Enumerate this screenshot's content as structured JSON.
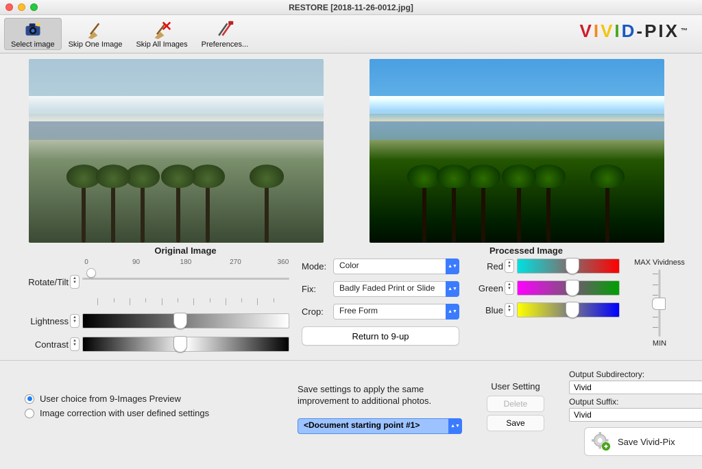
{
  "window": {
    "title": "RESTORE [2018-11-26-0012.jpg]"
  },
  "brand": {
    "word1": "VIVID",
    "word2": "-PIX"
  },
  "toolbar": {
    "select_image": "Select image",
    "skip_one": "Skip One Image",
    "skip_all": "Skip All Images",
    "preferences": "Preferences..."
  },
  "captions": {
    "original": "Original Image",
    "processed": "Processed Image"
  },
  "left_controls": {
    "rotate_label": "Rotate/Tilt",
    "rotate_ticks": [
      "0",
      "90",
      "180",
      "270",
      "360"
    ],
    "lightness_label": "Lightness",
    "contrast_label": "Contrast"
  },
  "mid_controls": {
    "mode_label": "Mode:",
    "mode_value": "Color",
    "fix_label": "Fix:",
    "fix_value": "Badly Faded Print or Slide",
    "crop_label": "Crop:",
    "crop_value": "Free Form",
    "return_label": "Return to 9-up"
  },
  "right_controls": {
    "red_label": "Red",
    "green_label": "Green",
    "blue_label": "Blue",
    "max_label": "MAX Vividness",
    "min_label": "MIN"
  },
  "bottom": {
    "radio1": "User choice from 9-Images Preview",
    "radio2": "Image correction with user defined settings",
    "save_hint": "Save settings to apply the same improvement to additional photos.",
    "doc_select": "<Document starting point #1>",
    "user_setting_hdr": "User Setting",
    "delete_btn": "Delete",
    "save_btn": "Save",
    "out_subdir_label": "Output Subdirectory:",
    "out_subdir_value": "Vivid",
    "out_suffix_label": "Output Suffix:",
    "out_suffix_value": "Vivid",
    "save_vivid": "Save Vivid-Pix"
  }
}
